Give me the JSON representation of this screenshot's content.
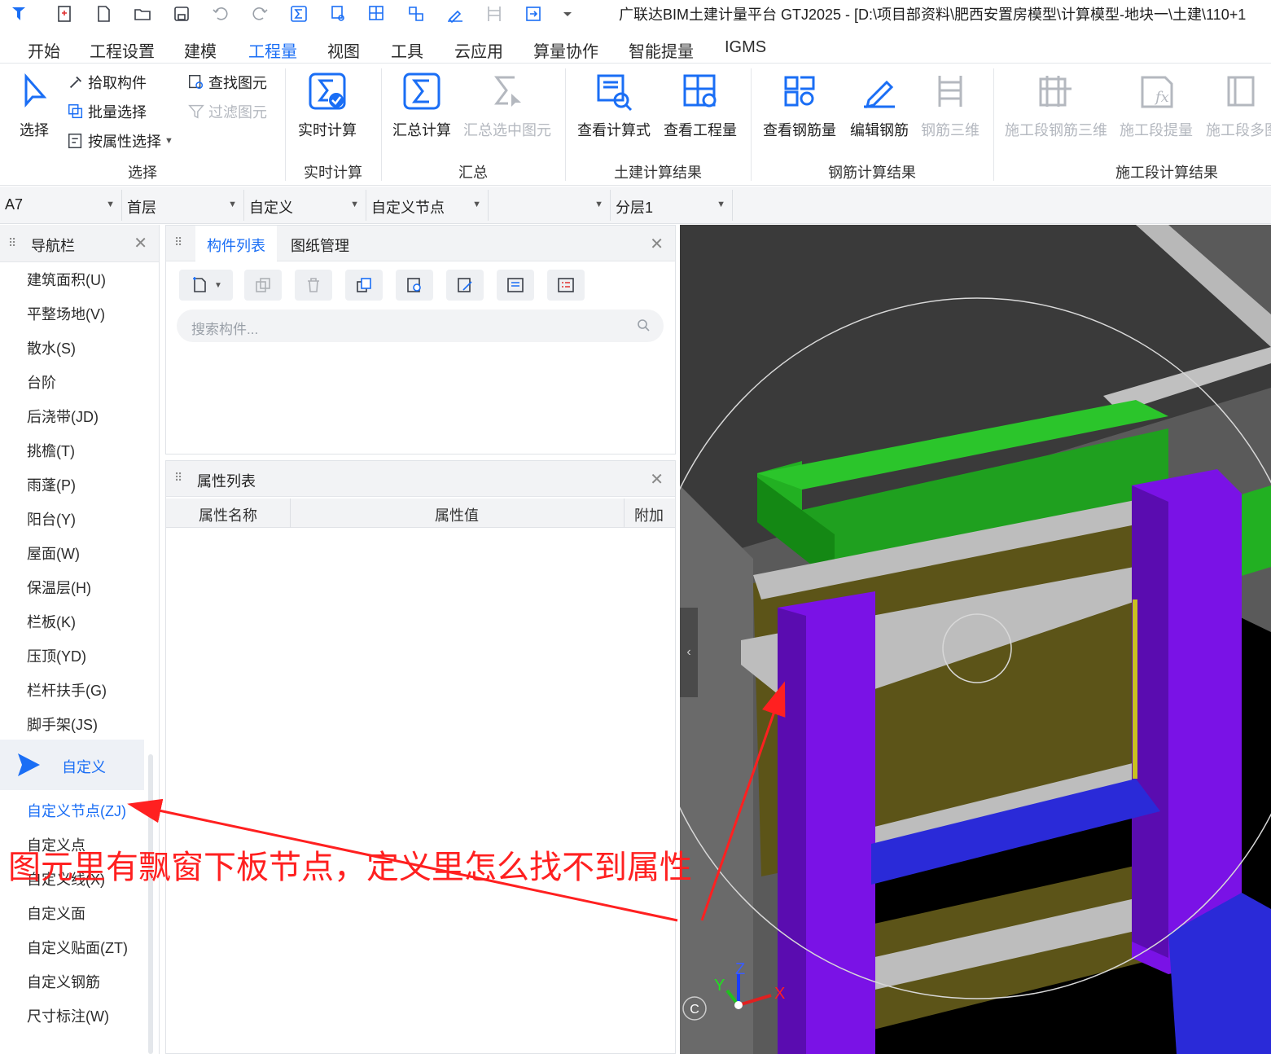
{
  "window": {
    "title": "广联达BIM土建计量平台 GTJ2025 - [D:\\项目部资料\\肥西安置房模型\\计算模型-地块一\\土建\\110+1"
  },
  "menu": {
    "tabs": [
      {
        "label": "开始"
      },
      {
        "label": "工程设置"
      },
      {
        "label": "建模"
      },
      {
        "label": "工程量"
      },
      {
        "label": "视图"
      },
      {
        "label": "工具"
      },
      {
        "label": "云应用"
      },
      {
        "label": "算量协作"
      },
      {
        "label": "智能提量"
      },
      {
        "label": "IGMS"
      }
    ],
    "active_tab": "工程量"
  },
  "ribbon": {
    "select": {
      "select_label": "选择",
      "pick_label": "拾取构件",
      "batch_label": "批量选择",
      "byattr_label": "按属性选择",
      "find_label": "查找图元",
      "filter_label": "过滤图元",
      "group_label": "选择"
    },
    "realtime": {
      "calc_label": "实时计算",
      "group_label": "实时计算"
    },
    "summary": {
      "sum_label": "汇总计算",
      "sum_selected_label": "汇总选中图元",
      "group_label": "汇总"
    },
    "civil": {
      "formula_label": "查看计算式",
      "quantity_label": "查看工程量",
      "group_label": "土建计算结果"
    },
    "rebar": {
      "view_label": "查看钢筋量",
      "edit_label": "编辑钢筋",
      "three_d_label": "钢筋三维",
      "group_label": "钢筋计算结果"
    },
    "stage": {
      "rebar3d_label": "施工段钢筋三维",
      "extract_label": "施工段提量",
      "multi_label": "施工段多图",
      "group_label": "施工段计算结果"
    }
  },
  "selectors": {
    "axis": "A7",
    "floor": "首层",
    "type": "自定义",
    "subtype": "自定义节点",
    "component": "",
    "layer": "分层1"
  },
  "nav": {
    "title": "导航栏",
    "items": [
      {
        "label": "建筑面积(U)"
      },
      {
        "label": "平整场地(V)"
      },
      {
        "label": "散水(S)"
      },
      {
        "label": "台阶"
      },
      {
        "label": "后浇带(JD)"
      },
      {
        "label": "挑檐(T)"
      },
      {
        "label": "雨蓬(P)"
      },
      {
        "label": "阳台(Y)"
      },
      {
        "label": "屋面(W)"
      },
      {
        "label": "保温层(H)"
      },
      {
        "label": "栏板(K)"
      },
      {
        "label": "压顶(YD)"
      },
      {
        "label": "栏杆扶手(G)"
      },
      {
        "label": "脚手架(JS)"
      }
    ],
    "group_label": "自定义",
    "sub_items": [
      {
        "label": "自定义节点(ZJ)"
      },
      {
        "label": "自定义点"
      },
      {
        "label": "自定义线(X)"
      },
      {
        "label": "自定义面"
      },
      {
        "label": "自定义贴面(ZT)"
      },
      {
        "label": "自定义钢筋"
      },
      {
        "label": "尺寸标注(W)"
      }
    ]
  },
  "component_panel": {
    "tabs": [
      {
        "label": "构件列表"
      },
      {
        "label": "图纸管理"
      }
    ],
    "search_placeholder": "搜索构件..."
  },
  "property_panel": {
    "title": "属性列表",
    "columns": [
      "属性名称",
      "属性值",
      "附加"
    ]
  },
  "viewport": {
    "axis_x": "X",
    "axis_y": "Y",
    "axis_z": "Z",
    "compass": "C"
  },
  "annotation": {
    "text": "图元里有飘窗下板节点，定义里怎么找不到属性",
    "color": "#ff2020"
  },
  "colors": {
    "accent": "#1a6ef5",
    "beam_green": "#22b022",
    "column_purple": "#7a12e6",
    "beam_blue": "#2a2ad8",
    "wall_olive": "#5c5418",
    "slab_gray": "#bdbdbd"
  }
}
